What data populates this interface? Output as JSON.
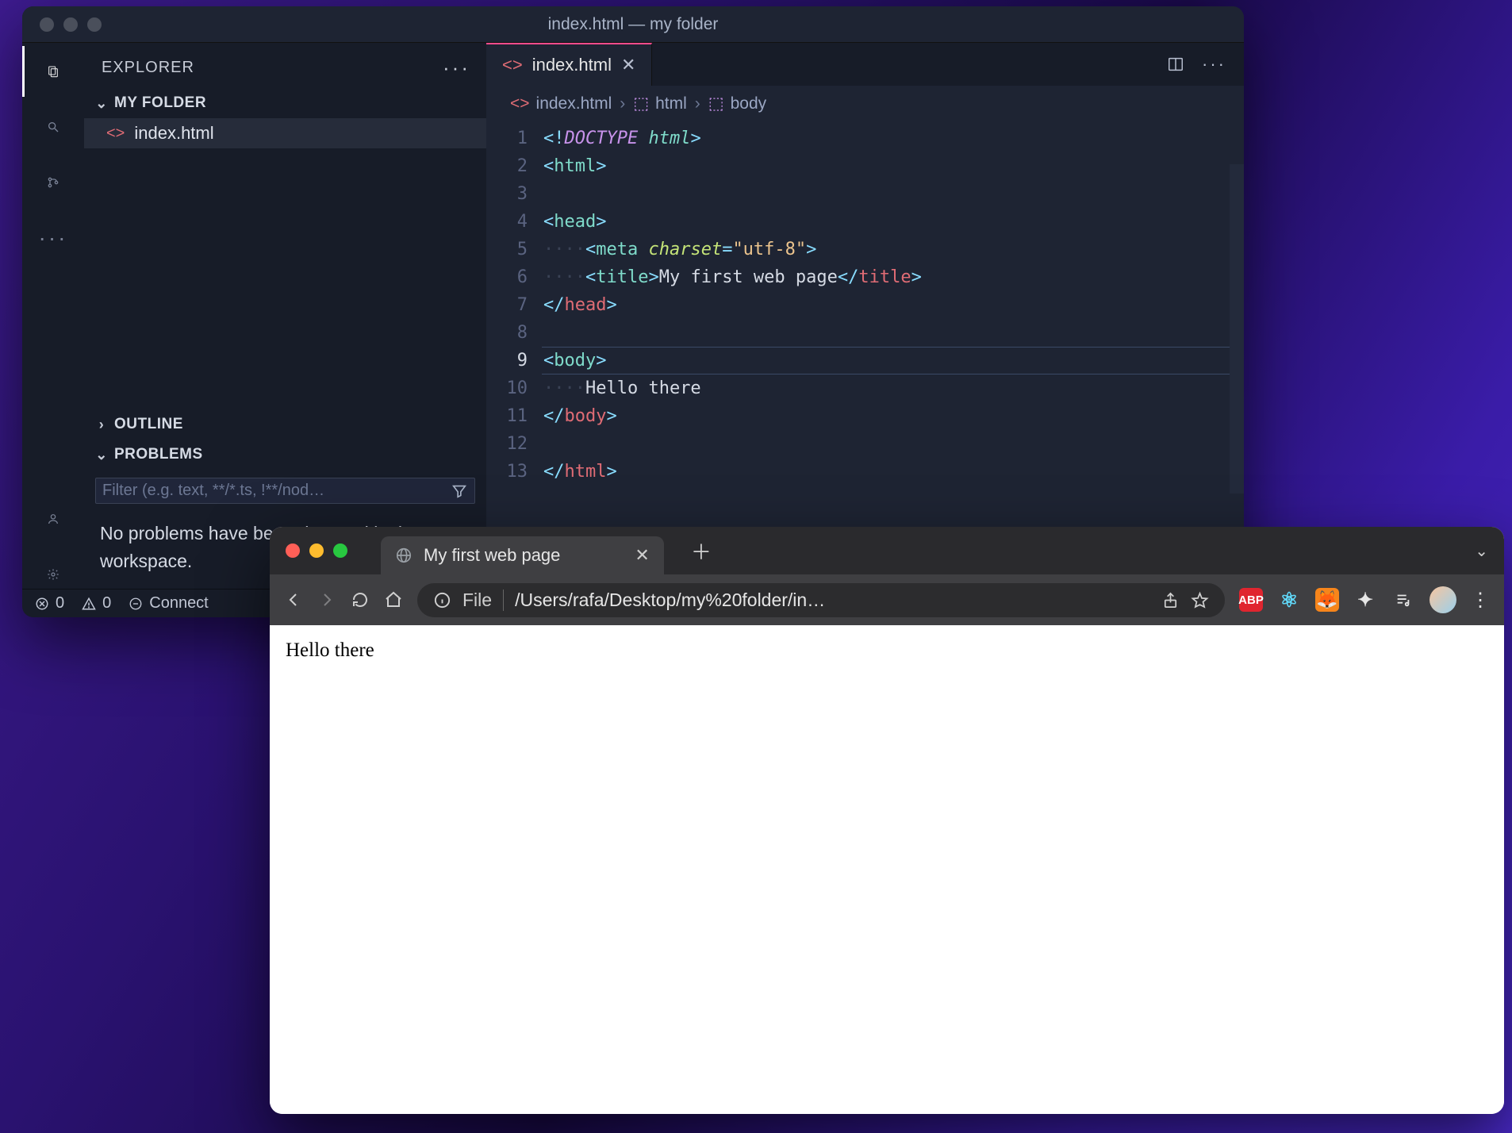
{
  "vscode": {
    "window_title": "index.html — my folder",
    "activitybar": [
      "files-icon",
      "search-icon",
      "source-control-icon",
      "more-icon",
      "account-icon",
      "settings-icon"
    ],
    "sidebar": {
      "header": "EXPLORER",
      "folder": "MY FOLDER",
      "files": [
        {
          "name": "index.html"
        }
      ],
      "outline_label": "OUTLINE",
      "problems_label": "PROBLEMS",
      "filter_placeholder": "Filter (e.g. text, **/*.ts, !**/nod…",
      "problems_msg": "No problems have been detected in the workspace."
    },
    "tab": {
      "name": "index.html"
    },
    "breadcrumb": [
      {
        "icon": "html-file-icon",
        "label": "index.html"
      },
      {
        "icon": "cube-icon",
        "label": "html"
      },
      {
        "icon": "cube-icon",
        "label": "body"
      }
    ],
    "code": {
      "line_numbers": [
        1,
        2,
        3,
        4,
        5,
        6,
        7,
        8,
        9,
        10,
        11,
        12,
        13
      ],
      "active_line": 9,
      "lines_tokens": [
        [
          {
            "c": "tk-punc",
            "t": "<!"
          },
          {
            "c": "tk-doctype",
            "t": "DOCTYPE "
          },
          {
            "c": "tk-doctype2",
            "t": "html"
          },
          {
            "c": "tk-punc",
            "t": ">"
          }
        ],
        [
          {
            "c": "tk-punc",
            "t": "<"
          },
          {
            "c": "tk-tag",
            "t": "html"
          },
          {
            "c": "tk-punc",
            "t": ">"
          }
        ],
        [],
        [
          {
            "c": "tk-punc",
            "t": "<"
          },
          {
            "c": "tk-tag",
            "t": "head"
          },
          {
            "c": "tk-punc",
            "t": ">"
          }
        ],
        [
          {
            "c": "indent-guide",
            "t": "····"
          },
          {
            "c": "tk-punc",
            "t": "<"
          },
          {
            "c": "tk-tag",
            "t": "meta "
          },
          {
            "c": "tk-attr",
            "t": "charset"
          },
          {
            "c": "tk-punc",
            "t": "="
          },
          {
            "c": "tk-str",
            "t": "\"utf-8\""
          },
          {
            "c": "tk-punc",
            "t": ">"
          }
        ],
        [
          {
            "c": "indent-guide",
            "t": "····"
          },
          {
            "c": "tk-punc",
            "t": "<"
          },
          {
            "c": "tk-tag",
            "t": "title"
          },
          {
            "c": "tk-punc",
            "t": ">"
          },
          {
            "c": "tk-text",
            "t": "My first web page"
          },
          {
            "c": "tk-punc",
            "t": "</"
          },
          {
            "c": "tk-ctag",
            "t": "title"
          },
          {
            "c": "tk-punc",
            "t": ">"
          }
        ],
        [
          {
            "c": "tk-punc",
            "t": "</"
          },
          {
            "c": "tk-ctag",
            "t": "head"
          },
          {
            "c": "tk-punc",
            "t": ">"
          }
        ],
        [],
        [
          {
            "c": "tk-punc",
            "t": "<"
          },
          {
            "c": "tk-body",
            "t": "body"
          },
          {
            "c": "tk-punc",
            "t": ">"
          }
        ],
        [
          {
            "c": "indent-guide",
            "t": "····"
          },
          {
            "c": "tk-text",
            "t": "Hello there"
          }
        ],
        [
          {
            "c": "tk-punc",
            "t": "</"
          },
          {
            "c": "tk-ctag",
            "t": "body"
          },
          {
            "c": "tk-punc",
            "t": ">"
          }
        ],
        [],
        [
          {
            "c": "tk-punc",
            "t": "</"
          },
          {
            "c": "tk-ctag",
            "t": "html"
          },
          {
            "c": "tk-punc",
            "t": ">"
          }
        ]
      ]
    },
    "statusbar": {
      "errors": "0",
      "warnings": "0",
      "connect": "Connect"
    }
  },
  "browser": {
    "tab_title": "My first web page",
    "addr_scheme": "File",
    "addr_path": "/Users/rafa/Desktop/my%20folder/in…",
    "extensions": [
      {
        "name": "abp",
        "label": "ABP"
      },
      {
        "name": "react",
        "label": "⚛"
      },
      {
        "name": "metamask",
        "label": "🦊"
      },
      {
        "name": "puzzle",
        "label": "✦"
      },
      {
        "name": "playlist",
        "label": "♪"
      }
    ],
    "page_text": "Hello there"
  }
}
